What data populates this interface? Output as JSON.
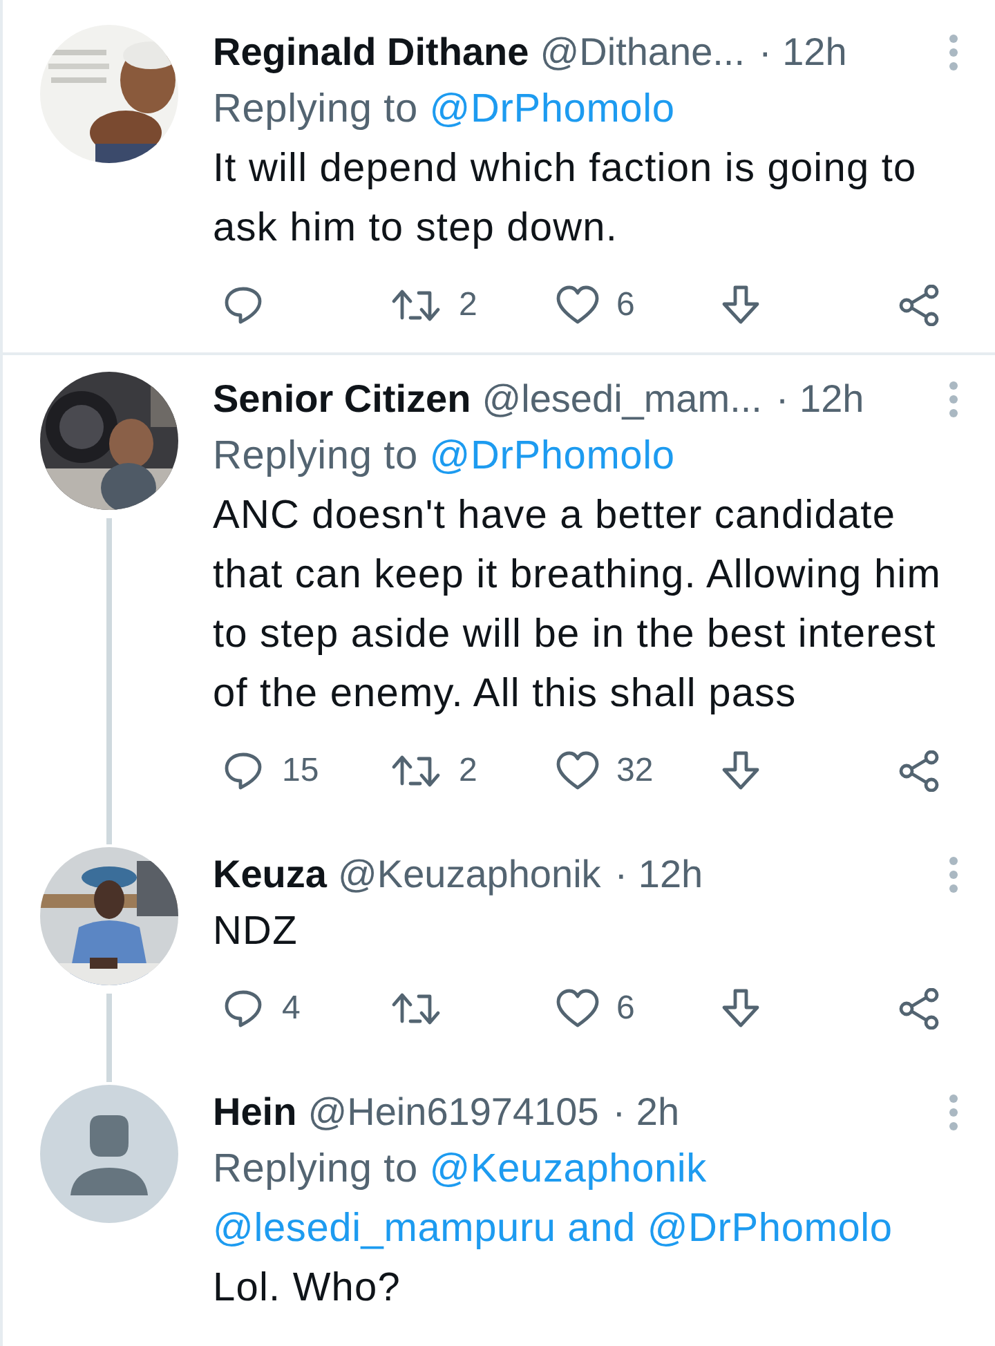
{
  "tweets": [
    {
      "name": "Reginald Dithane",
      "handle": "@Dithane...",
      "time": "· 12h",
      "replying": {
        "prefix": "Replying to",
        "targets": [
          "@DrPhomolo"
        ]
      },
      "text": "It will depend which faction is going to ask  him to step down.",
      "actions": {
        "retweets": "2",
        "likes": "6"
      },
      "thread_down": false,
      "divider": true
    },
    {
      "name": "Senior Citizen",
      "handle": "@lesedi_mam...",
      "time": "· 12h",
      "replying": {
        "prefix": "Replying to",
        "targets": [
          "@DrPhomolo"
        ]
      },
      "text": "ANC doesn't have a better candidate that can keep it breathing. Allowing him to step aside will be in the best interest of the enemy. All this shall pass",
      "actions": {
        "replies": "15",
        "retweets": "2",
        "likes": "32"
      },
      "thread_down": true,
      "divider": false
    },
    {
      "name": "Keuza",
      "handle": "@Keuzaphonik",
      "time": "· 12h",
      "text": "NDZ",
      "actions": {
        "replies": "4",
        "likes": "6"
      },
      "thread_down": true,
      "divider": false
    },
    {
      "avatar": {
        "kind": "default"
      },
      "name": "Hein",
      "handle": "@Hein61974105",
      "time": "· 2h",
      "replying": {
        "prefix": "Replying to",
        "targets": [
          "@Keuzaphonik",
          "@lesedi_mampuru and @DrPhomolo"
        ]
      },
      "text": "Lol. Who?",
      "thread_down": false,
      "divider": false
    }
  ]
}
